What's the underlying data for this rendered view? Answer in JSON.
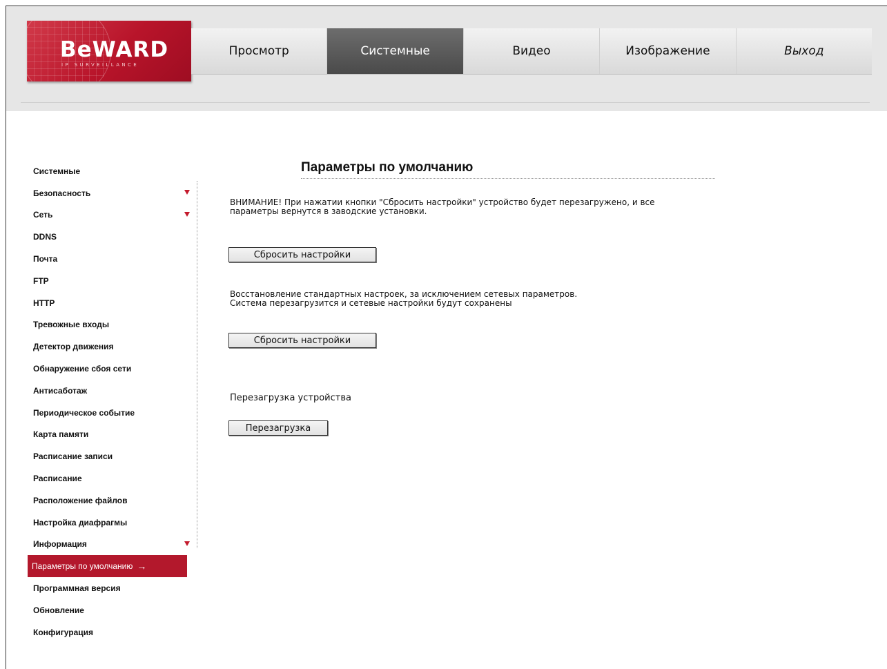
{
  "logo": {
    "brand": "BeWARD",
    "tagline": "IP SURVEILLANCE"
  },
  "nav": {
    "tabs": [
      {
        "label": "Просмотр"
      },
      {
        "label": "Системные"
      },
      {
        "label": "Видео"
      },
      {
        "label": "Изображение"
      },
      {
        "label": "Выход"
      }
    ],
    "active_index": 1
  },
  "sidebar": {
    "items": [
      {
        "label": "Системные"
      },
      {
        "label": "Безопасность",
        "expandable": true
      },
      {
        "label": "Сеть",
        "expandable": true
      },
      {
        "label": "DDNS"
      },
      {
        "label": "Почта"
      },
      {
        "label": "FTP"
      },
      {
        "label": "HTTP"
      },
      {
        "label": "Тревожные входы"
      },
      {
        "label": "Детектор движения"
      },
      {
        "label": "Обнаружение сбоя сети"
      },
      {
        "label": "Антисаботаж"
      },
      {
        "label": "Периодическое событие"
      },
      {
        "label": "Карта памяти"
      },
      {
        "label": "Расписание записи"
      },
      {
        "label": "Расписание"
      },
      {
        "label": "Расположение файлов"
      },
      {
        "label": "Настройка диафрагмы"
      },
      {
        "label": "Информация",
        "expandable": true
      },
      {
        "label": "Параметры по умолчанию",
        "active": true
      },
      {
        "label": "Программная версия"
      },
      {
        "label": "Обновление"
      },
      {
        "label": "Конфигурация"
      }
    ],
    "active_arrow": "→"
  },
  "main": {
    "title": "Параметры по умолчанию",
    "warning_line1": "ВНИМАНИЕ! При нажатии кнопки \"Сбросить настройки\" устройство будет перезагружено, и все",
    "warning_line2": "параметры вернутся в заводские установки.",
    "reset_all_label": "Сбросить настройки",
    "partial_line1": "Восстановление стандартных настроек, за исключением сетевых параметров.",
    "partial_line2": "Система перезагрузится и сетевые настройки будут сохранены",
    "reset_partial_label": "Сбросить настройки",
    "reboot_text": "Перезагрузка устройства",
    "reboot_label": "Перезагрузка"
  },
  "colors": {
    "brand_red": "#b3182c",
    "active_tab": "#4a4a4a",
    "header_bg": "#e6e6e6"
  }
}
